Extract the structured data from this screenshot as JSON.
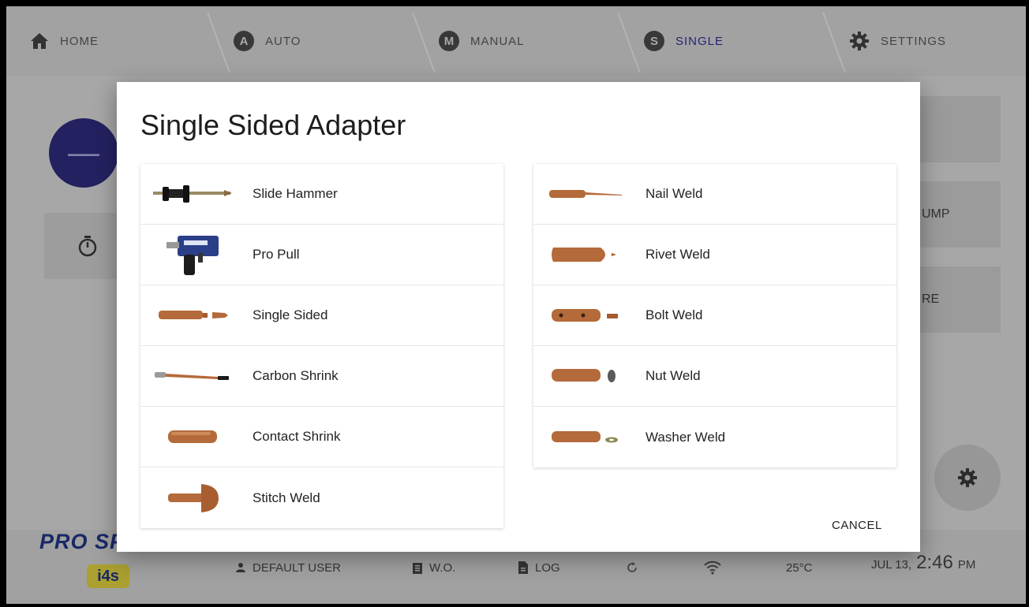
{
  "tabs": [
    {
      "label": "HOME",
      "icon": "home-icon"
    },
    {
      "label": "AUTO",
      "badge": "A"
    },
    {
      "label": "MANUAL",
      "badge": "M"
    },
    {
      "label": "SINGLE",
      "badge": "S",
      "active": true
    },
    {
      "label": "SETTINGS",
      "icon": "gear-icon"
    }
  ],
  "background": {
    "minus_symbol": "—",
    "right_cards": [
      "",
      "UMP",
      "RE"
    ]
  },
  "modal": {
    "title": "Single Sided Adapter",
    "left_items": [
      {
        "label": "Slide Hammer",
        "icon": "slide-hammer-icon"
      },
      {
        "label": "Pro Pull",
        "icon": "pro-pull-icon"
      },
      {
        "label": "Single Sided",
        "icon": "single-sided-icon"
      },
      {
        "label": "Carbon Shrink",
        "icon": "carbon-shrink-icon"
      },
      {
        "label": "Contact Shrink",
        "icon": "contact-shrink-icon"
      },
      {
        "label": "Stitch Weld",
        "icon": "stitch-weld-icon"
      }
    ],
    "right_items": [
      {
        "label": "Nail Weld",
        "icon": "nail-weld-icon"
      },
      {
        "label": "Rivet Weld",
        "icon": "rivet-weld-icon"
      },
      {
        "label": "Bolt Weld",
        "icon": "bolt-weld-icon"
      },
      {
        "label": "Nut Weld",
        "icon": "nut-weld-icon"
      },
      {
        "label": "Washer Weld",
        "icon": "washer-weld-icon"
      }
    ],
    "cancel_label": "CANCEL"
  },
  "bottom": {
    "logo_text": "PRO SPOT",
    "logo_badge": "i4s",
    "user_label": "DEFAULT USER",
    "wo_label": "W.O.",
    "log_label": "LOG",
    "temperature": "25°C",
    "date": "JUL 13,",
    "time": "2:46",
    "ampm": "PM"
  },
  "colors": {
    "accent": "#2a2a8a",
    "copper": "#b46a3a",
    "minus_button": "#2a2772",
    "logo_badge": "#c8bb39"
  }
}
